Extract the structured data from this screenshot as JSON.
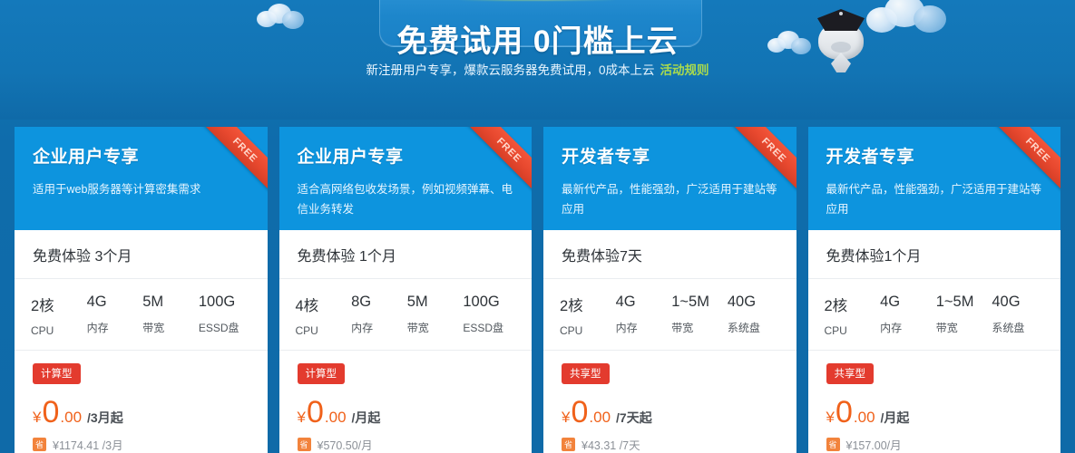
{
  "hero": {
    "title": "免费试用 0门槛上云",
    "subtitle": "新注册用户专享，爆款云服务器免费试用，0成本上云",
    "rule_link": "活动规则"
  },
  "ribbon_label": "FREE",
  "save_badge_char": "省",
  "colors": {
    "page_bg": "#0f6caa",
    "card_head": "#0d94de",
    "ribbon": "#e8492f",
    "price": "#f0611a",
    "type_badge": "#e33b2e",
    "rule_link": "#a9da4e"
  },
  "cards": [
    {
      "title": "企业用户专享",
      "desc": "适用于web服务器等计算密集需求",
      "trial": "免费体验 3个月",
      "specs": [
        {
          "value": "2核",
          "label": "CPU"
        },
        {
          "value": "4G",
          "label": "内存"
        },
        {
          "value": "5M",
          "label": "带宽"
        },
        {
          "value": "100G",
          "label": "ESSD盘"
        }
      ],
      "type": "计算型",
      "price_yen": "¥",
      "price_int": "0",
      "price_dec": ".00",
      "price_unit": "/3月起",
      "orig_price": "¥1174.41 /3月"
    },
    {
      "title": "企业用户专享",
      "desc": "适合高网络包收发场景，例如视频弹幕、电信业务转发",
      "trial": "免费体验 1个月",
      "specs": [
        {
          "value": "4核",
          "label": "CPU"
        },
        {
          "value": "8G",
          "label": "内存"
        },
        {
          "value": "5M",
          "label": "带宽"
        },
        {
          "value": "100G",
          "label": "ESSD盘"
        }
      ],
      "type": "计算型",
      "price_yen": "¥",
      "price_int": "0",
      "price_dec": ".00",
      "price_unit": "/月起",
      "orig_price": "¥570.50/月"
    },
    {
      "title": "开发者专享",
      "desc": "最新代产品，性能强劲，广泛适用于建站等应用",
      "trial": "免费体验7天",
      "specs": [
        {
          "value": "2核",
          "label": "CPU"
        },
        {
          "value": "4G",
          "label": "内存"
        },
        {
          "value": "1~5M",
          "label": "带宽"
        },
        {
          "value": "40G",
          "label": "系统盘"
        }
      ],
      "type": "共享型",
      "price_yen": "¥",
      "price_int": "0",
      "price_dec": ".00",
      "price_unit": "/7天起",
      "orig_price": "¥43.31 /7天"
    },
    {
      "title": "开发者专享",
      "desc": "最新代产品，性能强劲，广泛适用于建站等应用",
      "trial": "免费体验1个月",
      "specs": [
        {
          "value": "2核",
          "label": "CPU"
        },
        {
          "value": "4G",
          "label": "内存"
        },
        {
          "value": "1~5M",
          "label": "带宽"
        },
        {
          "value": "40G",
          "label": "系统盘"
        }
      ],
      "type": "共享型",
      "price_yen": "¥",
      "price_int": "0",
      "price_dec": ".00",
      "price_unit": "/月起",
      "orig_price": "¥157.00/月"
    }
  ]
}
